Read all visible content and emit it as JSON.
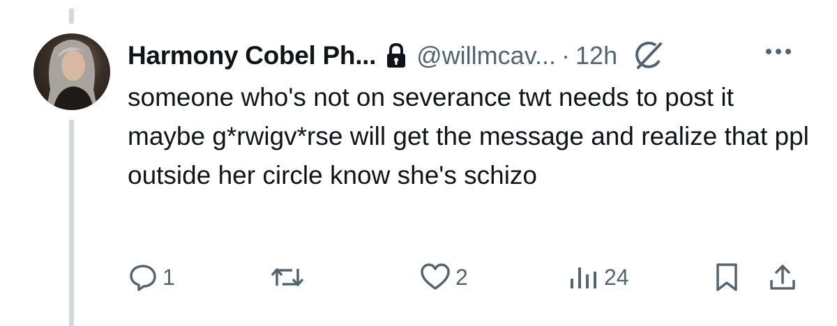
{
  "tweet": {
    "author_name": "Harmony Cobel Ph...",
    "handle": "@willmcav...",
    "separator": "·",
    "time": "12h",
    "text": "someone who's not on severance twt needs to post it maybe g*rwigv*rse will get the message and realize that ppl outside her circle know she's schizo"
  },
  "actions": {
    "reply_count": "1",
    "retweet_count": "",
    "like_count": "2",
    "views_count": "24"
  },
  "icons": {
    "lock": "lock-icon",
    "grok": "grok-icon",
    "more": "more-icon",
    "reply": "reply-icon",
    "retweet": "retweet-icon",
    "like": "heart-icon",
    "views": "views-icon",
    "bookmark": "bookmark-icon",
    "share": "share-icon"
  },
  "colors": {
    "text": "#0f1419",
    "secondary": "#536471",
    "thread_line": "#cfd9de",
    "background": "#ffffff"
  }
}
